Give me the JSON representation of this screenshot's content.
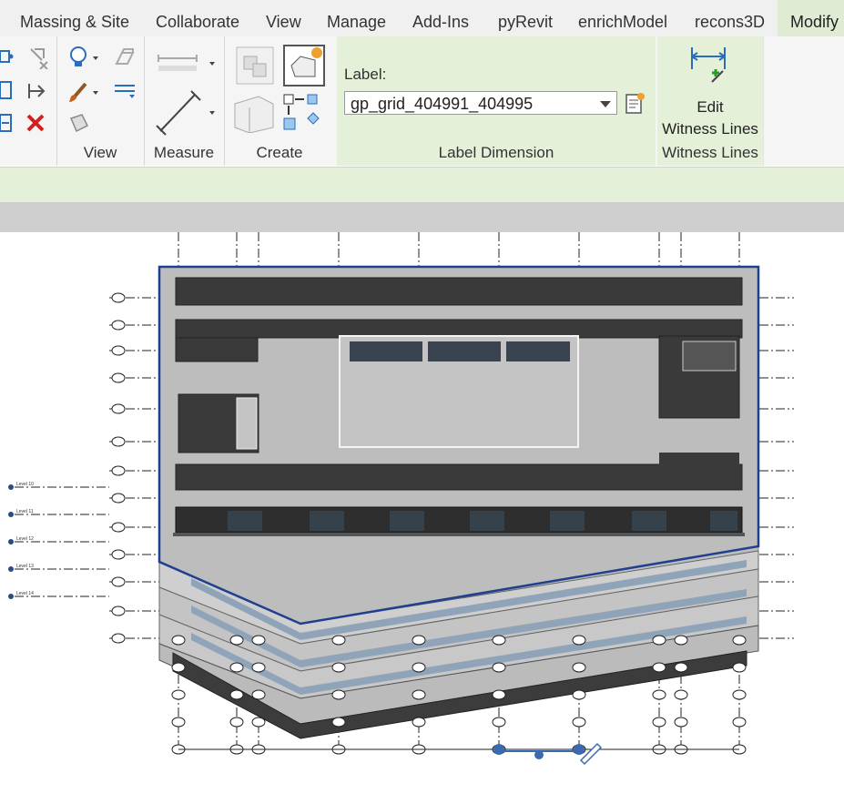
{
  "tabs": [
    "Massing & Site",
    "Collaborate",
    "View",
    "Manage",
    "Add-Ins",
    "pyRevit",
    "enrichModel",
    "recons3D",
    "Modify"
  ],
  "active_tab": "Modify",
  "panels": {
    "view": "View",
    "measure": "Measure",
    "create": "Create",
    "label_dimension": "Label Dimension",
    "witness_lines": "Witness Lines"
  },
  "label_dimension": {
    "label_caption": "Label:",
    "selected_label": "gp_grid_404991_404995"
  },
  "witness": {
    "button_line1": "Edit",
    "button_line2": "Witness Lines"
  },
  "level_tags": [
    "Level 10",
    "Level 11",
    "Level 12",
    "Level 13",
    "Level 14"
  ],
  "colors": {
    "ribbon_bg": "#f5f5f5",
    "context_green": "#e4f0d8",
    "selection_blue": "#1f3f8f",
    "facade_dark": "#3a3a3a",
    "facade_grey": "#bdbdbd"
  }
}
